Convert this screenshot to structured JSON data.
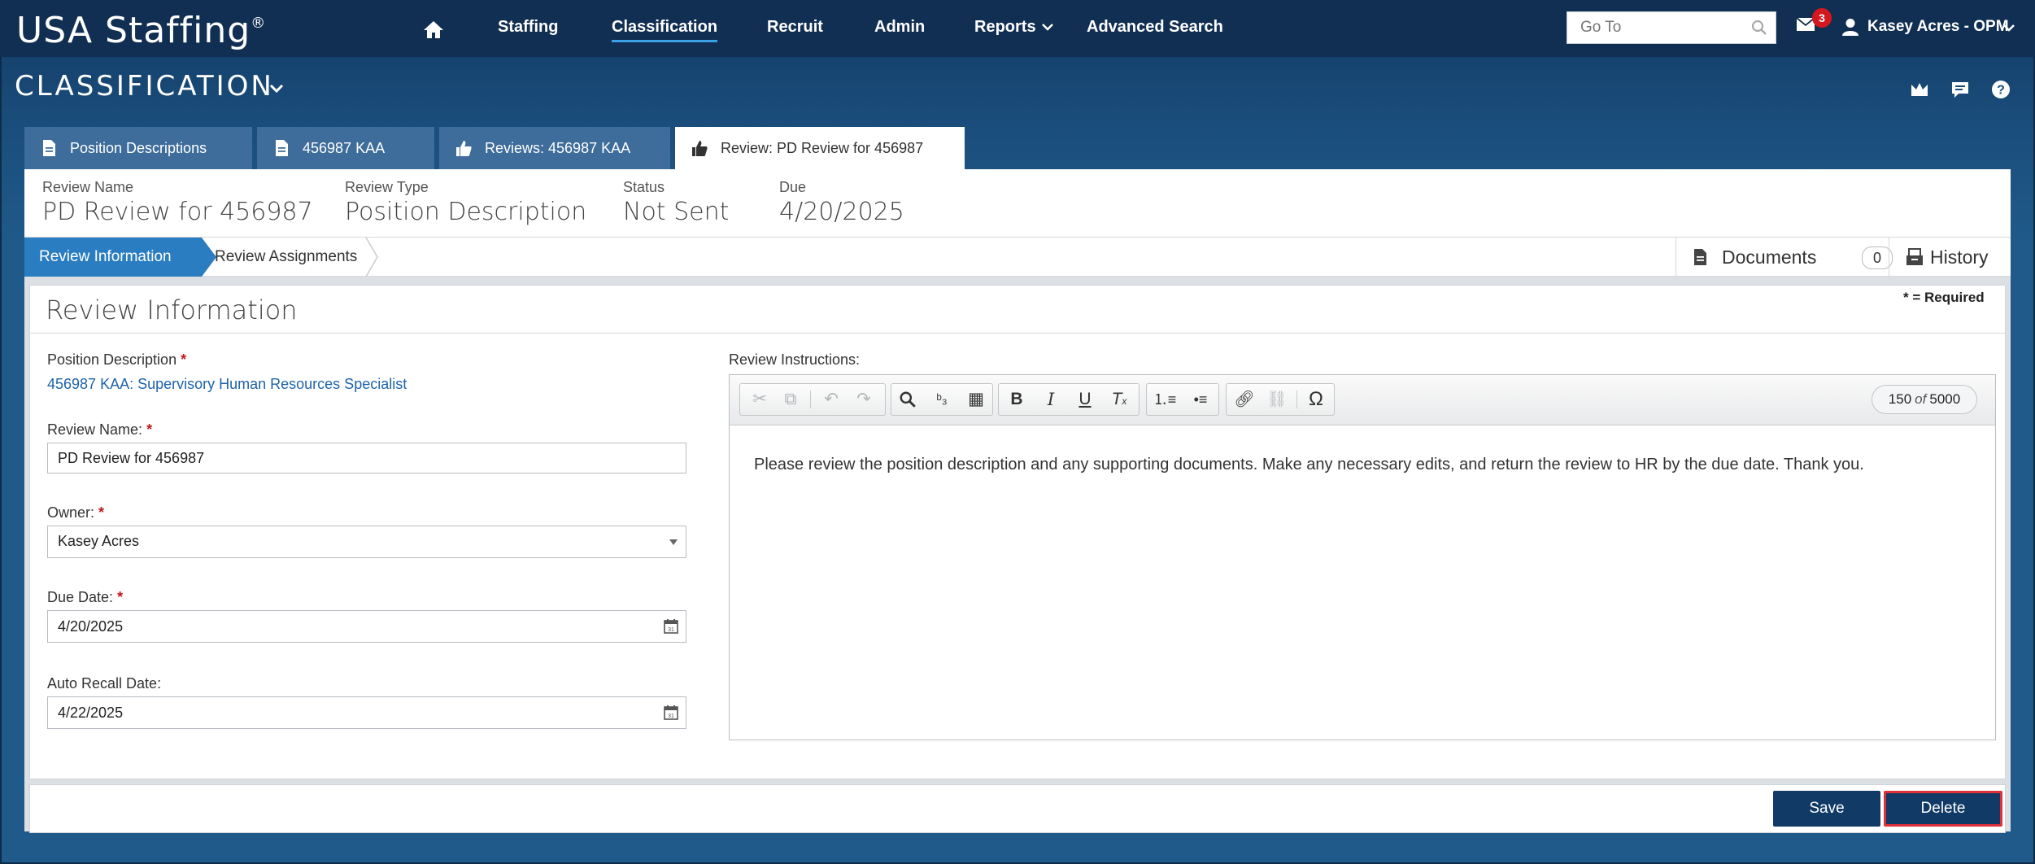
{
  "header": {
    "brand": "USA Staffing",
    "brand_mark": "®",
    "nav": {
      "staffing": "Staffing",
      "classification": "Classification",
      "recruit": "Recruit",
      "admin": "Admin",
      "reports": "Reports",
      "advanced_search": "Advanced Search"
    },
    "goto_placeholder": "Go To",
    "mail_count": "3",
    "user_name": "Kasey Acres - OPM"
  },
  "module": {
    "title": "CLASSIFICATION"
  },
  "tabs": [
    {
      "label": "Position Descriptions",
      "icon": "document-icon"
    },
    {
      "label": "456987 KAA",
      "icon": "document-icon"
    },
    {
      "label": "Reviews: 456987 KAA",
      "icon": "thumbs-up-icon"
    },
    {
      "label": "Review: PD Review for 456987",
      "icon": "thumbs-up-icon",
      "active": true
    }
  ],
  "summary": {
    "review_name_label": "Review Name",
    "review_name": "PD Review for 456987",
    "review_type_label": "Review Type",
    "review_type": "Position Description",
    "status_label": "Status",
    "status": "Not Sent",
    "due_label": "Due",
    "due": "4/20/2025"
  },
  "steps": {
    "step1": "Review Information",
    "step2": "Review Assignments",
    "documents_label": "Documents",
    "documents_count": "0",
    "history_label": "History"
  },
  "form": {
    "section_title": "Review Information",
    "required_note": "* = Required",
    "pd_label": "Position Description",
    "pd_value": "456987 KAA: Supervisory Human Resources Specialist",
    "review_name_label": "Review Name:",
    "review_name_value": "PD Review for 456987",
    "owner_label": "Owner:",
    "owner_value": "Kasey Acres",
    "due_date_label": "Due Date:",
    "due_date_value": "4/20/2025",
    "auto_recall_label": "Auto Recall Date:",
    "auto_recall_value": "4/22/2025",
    "required_mark": "*"
  },
  "editor": {
    "label": "Review Instructions:",
    "char_used": "150",
    "char_of": "of",
    "char_max": "5000",
    "text": "Please review the position description and any supporting documents. Make any necessary edits, and return the review to HR by the due date. Thank you."
  },
  "footer": {
    "save": "Save",
    "delete": "Delete"
  },
  "colors": {
    "topbar": "#112f52",
    "accent": "#2a7dc0",
    "button": "#113b66",
    "required": "#c0181d",
    "badge": "#d3181e"
  }
}
